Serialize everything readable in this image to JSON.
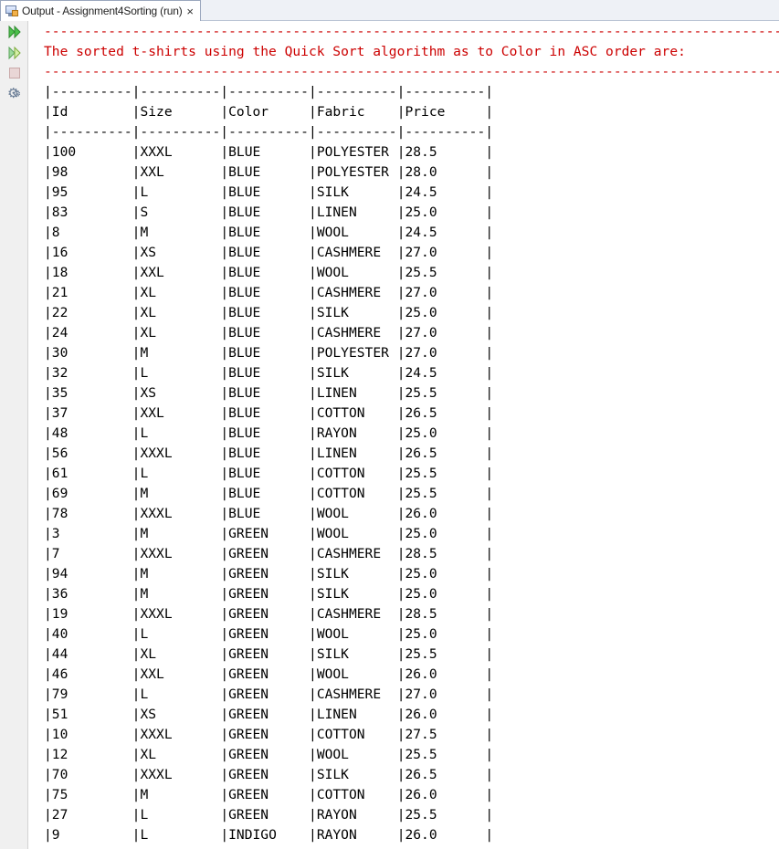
{
  "window": {
    "tab_title": "Output - Assignment4Sorting (run)",
    "close_glyph": "×"
  },
  "toolbar": {
    "icons": [
      "rerun-icon",
      "rerun-with-options-icon",
      "stop-icon",
      "settings-icon"
    ]
  },
  "output": {
    "separator": "--------------------------------------------------------------------------------------------",
    "heading": "The sorted t-shirts using the Quick Sort algorithm as to Color in ASC order are:",
    "table_border": "|----------|----------|----------|----------|----------|",
    "columns": [
      "Id",
      "Size",
      "Color",
      "Fabric",
      "Price"
    ],
    "rows": [
      [
        "100",
        "XXXL",
        "BLUE",
        "POLYESTER",
        "28.5"
      ],
      [
        "98",
        "XXL",
        "BLUE",
        "POLYESTER",
        "28.0"
      ],
      [
        "95",
        "L",
        "BLUE",
        "SILK",
        "24.5"
      ],
      [
        "83",
        "S",
        "BLUE",
        "LINEN",
        "25.0"
      ],
      [
        "8",
        "M",
        "BLUE",
        "WOOL",
        "24.5"
      ],
      [
        "16",
        "XS",
        "BLUE",
        "CASHMERE",
        "27.0"
      ],
      [
        "18",
        "XXL",
        "BLUE",
        "WOOL",
        "25.5"
      ],
      [
        "21",
        "XL",
        "BLUE",
        "CASHMERE",
        "27.0"
      ],
      [
        "22",
        "XL",
        "BLUE",
        "SILK",
        "25.0"
      ],
      [
        "24",
        "XL",
        "BLUE",
        "CASHMERE",
        "27.0"
      ],
      [
        "30",
        "M",
        "BLUE",
        "POLYESTER",
        "27.0"
      ],
      [
        "32",
        "L",
        "BLUE",
        "SILK",
        "24.5"
      ],
      [
        "35",
        "XS",
        "BLUE",
        "LINEN",
        "25.5"
      ],
      [
        "37",
        "XXL",
        "BLUE",
        "COTTON",
        "26.5"
      ],
      [
        "48",
        "L",
        "BLUE",
        "RAYON",
        "25.0"
      ],
      [
        "56",
        "XXXL",
        "BLUE",
        "LINEN",
        "26.5"
      ],
      [
        "61",
        "L",
        "BLUE",
        "COTTON",
        "25.5"
      ],
      [
        "69",
        "M",
        "BLUE",
        "COTTON",
        "25.5"
      ],
      [
        "78",
        "XXXL",
        "BLUE",
        "WOOL",
        "26.0"
      ],
      [
        "3",
        "M",
        "GREEN",
        "WOOL",
        "25.0"
      ],
      [
        "7",
        "XXXL",
        "GREEN",
        "CASHMERE",
        "28.5"
      ],
      [
        "94",
        "M",
        "GREEN",
        "SILK",
        "25.0"
      ],
      [
        "36",
        "M",
        "GREEN",
        "SILK",
        "25.0"
      ],
      [
        "19",
        "XXXL",
        "GREEN",
        "CASHMERE",
        "28.5"
      ],
      [
        "40",
        "L",
        "GREEN",
        "WOOL",
        "25.0"
      ],
      [
        "44",
        "XL",
        "GREEN",
        "SILK",
        "25.5"
      ],
      [
        "46",
        "XXL",
        "GREEN",
        "WOOL",
        "26.0"
      ],
      [
        "79",
        "L",
        "GREEN",
        "CASHMERE",
        "27.0"
      ],
      [
        "51",
        "XS",
        "GREEN",
        "LINEN",
        "26.0"
      ],
      [
        "10",
        "XXXL",
        "GREEN",
        "COTTON",
        "27.5"
      ],
      [
        "12",
        "XL",
        "GREEN",
        "WOOL",
        "25.5"
      ],
      [
        "70",
        "XXXL",
        "GREEN",
        "SILK",
        "26.5"
      ],
      [
        "75",
        "M",
        "GREEN",
        "COTTON",
        "26.0"
      ],
      [
        "27",
        "L",
        "GREEN",
        "RAYON",
        "25.5"
      ],
      [
        "9",
        "L",
        "INDIGO",
        "RAYON",
        "26.0"
      ]
    ]
  },
  "colors": {
    "console_error_red": "#cc0000",
    "console_text": "#000000",
    "tab_border": "#9aa7bd"
  }
}
